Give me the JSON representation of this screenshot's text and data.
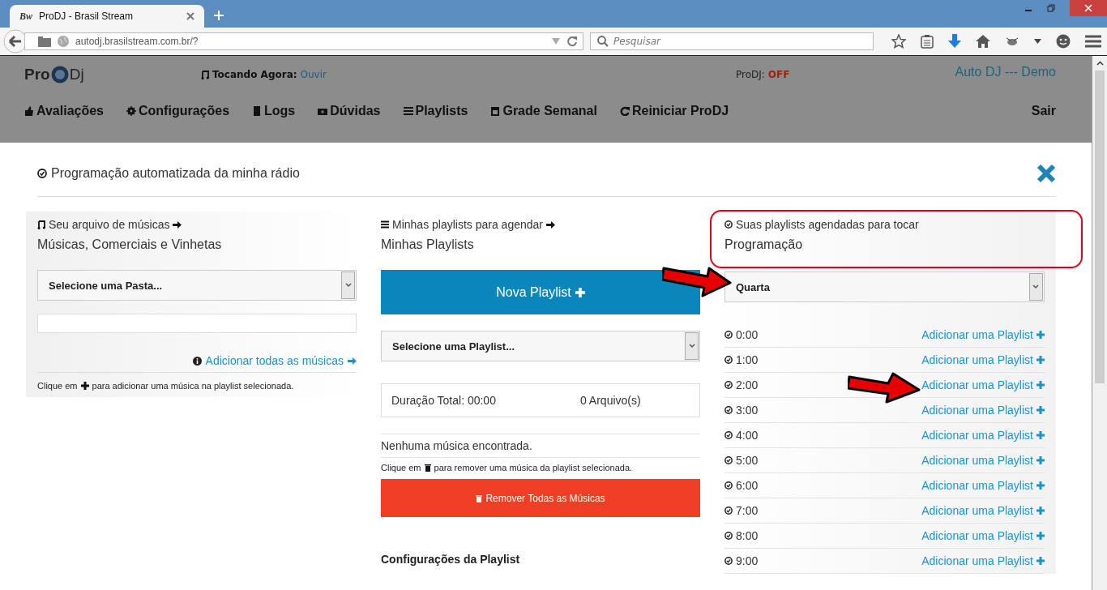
{
  "browser": {
    "tab_title": "ProDJ - Brasil Stream",
    "tab_logo": "Bw",
    "url": "autodj.brasilstream.com.br/?",
    "search_placeholder": "Pesquisar"
  },
  "header": {
    "logo_left": "Pro",
    "logo_right": "Dj",
    "now_playing_label": "Tocando Agora:",
    "listen_link": "Ouvir",
    "status_label": "ProDJ:",
    "status_value": "OFF",
    "account": "Auto DJ --- Demo",
    "nav": [
      {
        "label": "Avaliações"
      },
      {
        "label": "Configurações"
      },
      {
        "label": "Logs"
      },
      {
        "label": "Dúvidas"
      },
      {
        "label": "Playlists"
      },
      {
        "label": "Grade Semanal"
      },
      {
        "label": "Reiniciar ProDJ"
      }
    ],
    "logout": "Sair"
  },
  "modal": {
    "title": "Programação automatizada da minha rádio",
    "library": {
      "caption": "Seu arquivo de músicas",
      "heading": "Músicas, Comerciais e Vinhetas",
      "folder_select": "Selecione uma Pasta...",
      "add_all_link": "Adicionar todas as músicas",
      "hint_before": "Clique em",
      "hint_after": "para adicionar uma música na playlist selecionada."
    },
    "playlists": {
      "caption": "Minhas playlists para agendar",
      "heading": "Minhas Playlists",
      "new_button": "Nova Playlist",
      "playlist_select": "Selecione uma Playlist...",
      "duration": "Duração Total: 00:00",
      "files": "0 Arquivo(s)",
      "empty": "Nenhuma música encontrada.",
      "hint_before": "Clique em",
      "hint_after": "para remover uma música da playlist selecionada.",
      "remove_button": "Remover Todas as Músicas",
      "settings_heading": "Configurações da Playlist"
    },
    "schedule": {
      "caption": "Suas playlists agendadas para tocar",
      "heading": "Programação",
      "day_select": "Quarta",
      "rows": [
        {
          "time": "0:00",
          "action": "Adicionar uma Playlist"
        },
        {
          "time": "1:00",
          "action": "Adicionar uma Playlist"
        },
        {
          "time": "2:00",
          "action": "Adicionar uma Playlist"
        },
        {
          "time": "3:00",
          "action": "Adicionar uma Playlist"
        },
        {
          "time": "4:00",
          "action": "Adicionar uma Playlist"
        },
        {
          "time": "5:00",
          "action": "Adicionar uma Playlist"
        },
        {
          "time": "6:00",
          "action": "Adicionar uma Playlist"
        },
        {
          "time": "7:00",
          "action": "Adicionar uma Playlist"
        },
        {
          "time": "8:00",
          "action": "Adicionar uma Playlist"
        },
        {
          "time": "9:00",
          "action": "Adicionar uma Playlist"
        }
      ]
    }
  }
}
